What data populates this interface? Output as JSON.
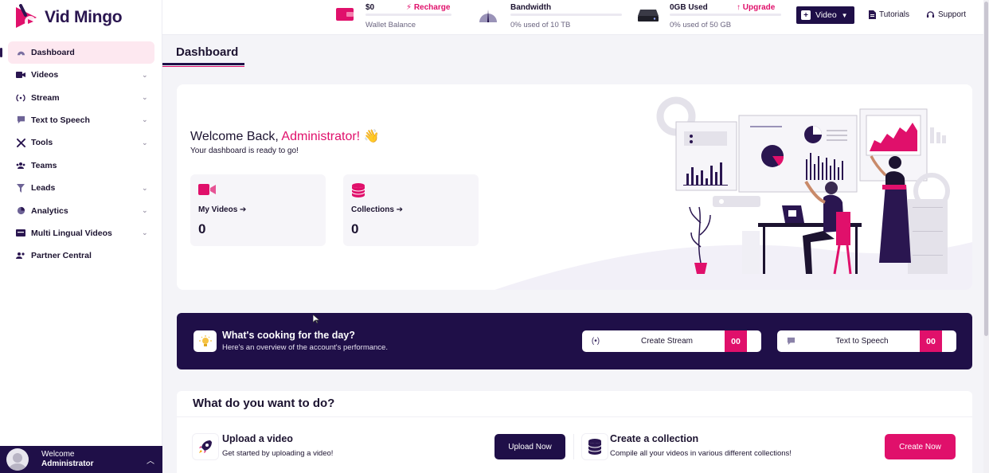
{
  "brand": {
    "name_part1": "Vid",
    "name_part2": "Mingo",
    "accent": "#e0106b",
    "dark": "#1f0f48"
  },
  "sidebar": {
    "items": [
      {
        "label": "Dashboard",
        "icon": "dashboard-icon",
        "active": true
      },
      {
        "label": "Videos",
        "icon": "video-camera-icon",
        "expandable": true
      },
      {
        "label": "Stream",
        "icon": "broadcast-icon",
        "expandable": true
      },
      {
        "label": "Text to Speech",
        "icon": "speech-bubble-icon",
        "expandable": true
      },
      {
        "label": "Tools",
        "icon": "tools-icon",
        "expandable": true
      },
      {
        "label": "Teams",
        "icon": "users-icon"
      },
      {
        "label": "Leads",
        "icon": "funnel-icon",
        "expandable": true
      },
      {
        "label": "Analytics",
        "icon": "pie-chart-icon",
        "expandable": true
      },
      {
        "label": "Multi Lingual Videos",
        "icon": "language-icon",
        "expandable": true
      },
      {
        "label": "Partner Central",
        "icon": "partners-icon"
      }
    ],
    "footer": {
      "greeting": "Welcome",
      "username": "Administrator"
    }
  },
  "topbar": {
    "wallet": {
      "amount": "$0",
      "action": "Recharge",
      "label": "Wallet Balance"
    },
    "bandwidth": {
      "title": "Bandwidth",
      "usage": "0% used of 10 TB",
      "percent": 0
    },
    "storage": {
      "title": "0GB Used",
      "action": "Upgrade",
      "usage": "0% used of 50 GB",
      "percent": 0
    },
    "create_button": "Video",
    "tutorials": "Tutorials",
    "support": "Support"
  },
  "page": {
    "title": "Dashboard"
  },
  "welcome": {
    "greeting": "Welcome Back,",
    "name": "Administrator!",
    "emoji": "👋",
    "subtitle": "Your dashboard is ready to go!",
    "stats": [
      {
        "label": "My Videos ➔",
        "value": "0",
        "icon": "video-camera-icon"
      },
      {
        "label": "Collections ➔",
        "value": "0",
        "icon": "database-icon"
      }
    ]
  },
  "banner": {
    "title": "What's cooking for the day?",
    "subtitle": "Here's an overview of the account's performance.",
    "pills": [
      {
        "label": "Create Stream",
        "count": "00",
        "icon": "broadcast-icon"
      },
      {
        "label": "Text to Speech",
        "count": "00",
        "icon": "speech-bubble-icon"
      }
    ]
  },
  "todo": {
    "heading": "What do you want to do?",
    "items": [
      {
        "title": "Upload a video",
        "subtitle": "Get started by uploading a video!",
        "button": "Upload Now",
        "icon": "rocket-icon"
      },
      {
        "title": "Create a collection",
        "subtitle": "Compile all your videos in various different collections!",
        "button": "Create Now",
        "icon": "database-icon"
      }
    ]
  }
}
